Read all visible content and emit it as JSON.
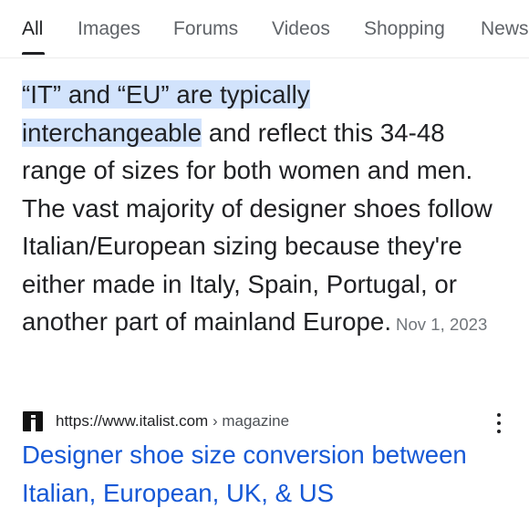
{
  "tabs": [
    {
      "label": "All",
      "active": true
    },
    {
      "label": "Images",
      "active": false
    },
    {
      "label": "Forums",
      "active": false
    },
    {
      "label": "Videos",
      "active": false
    },
    {
      "label": "Shopping",
      "active": false
    },
    {
      "label": "News",
      "active": false
    }
  ],
  "snippet": {
    "highlight_line1": "“IT” and “EU” are typically",
    "highlight_line2": "interchangeable",
    "rest": " and reflect this 34-48 range of sizes for both women and men. The vast majority of designer shoes follow Italian/European sizing because they're either made in Italy, Spain, Portugal, or another part of mainland Europe.",
    "date": "Nov 1, 2023"
  },
  "result": {
    "favicon_icon": "italist-logo-icon",
    "url": "https://www.italist.com",
    "path": " › magazine",
    "more_icon": "more-vert-icon",
    "title": "Designer shoe size conversion between Italian, European, UK, & US"
  },
  "colors": {
    "highlight": "#d2e3fc",
    "link": "#1558d6",
    "text": "#202124",
    "muted": "#70757a"
  }
}
